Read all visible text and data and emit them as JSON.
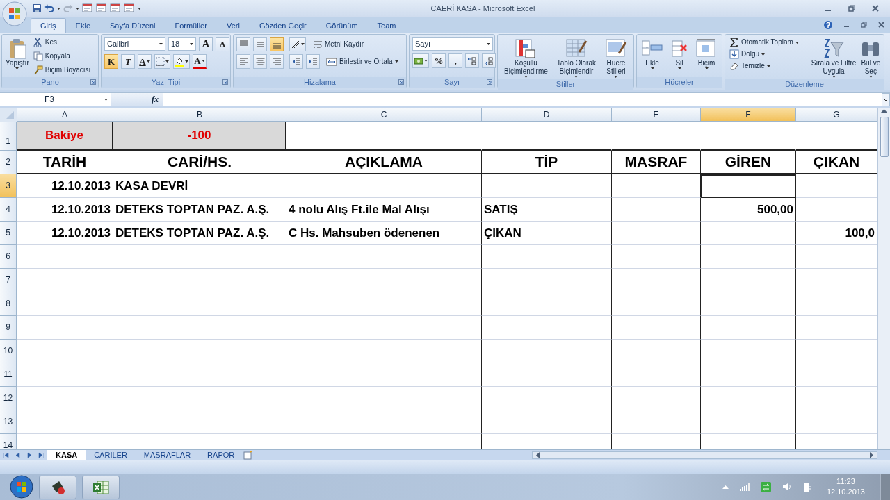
{
  "window": {
    "title": "CAERİ KASA - Microsoft Excel"
  },
  "ribbon_tabs": [
    {
      "label": "Giriş",
      "selected": true
    },
    {
      "label": "Ekle",
      "selected": false
    },
    {
      "label": "Sayfa Düzeni",
      "selected": false
    },
    {
      "label": "Formüller",
      "selected": false
    },
    {
      "label": "Veri",
      "selected": false
    },
    {
      "label": "Gözden Geçir",
      "selected": false
    },
    {
      "label": "Görünüm",
      "selected": false
    },
    {
      "label": "Team",
      "selected": false
    }
  ],
  "clipboard": {
    "label": "Pano",
    "paste": "Yapıştır",
    "commands": [
      "Kes",
      "Kopyala",
      "Biçim Boyacısı"
    ]
  },
  "font": {
    "label": "Yazı Tipi",
    "name": "Calibri",
    "size": "18",
    "grow": "A",
    "shrink": "A",
    "styles": [
      {
        "kind": "bold",
        "label": "K",
        "on": true
      },
      {
        "kind": "italic",
        "label": "T",
        "on": false
      },
      {
        "kind": "underline",
        "label": "A",
        "on": false
      }
    ],
    "color_button": "A"
  },
  "alignment": {
    "label": "Hizalama",
    "vertical": [
      {
        "kind": "top",
        "on": false
      },
      {
        "kind": "middle",
        "on": false
      },
      {
        "kind": "bottom",
        "on": true
      }
    ],
    "wrap": "Metni Kaydır",
    "merge": "Birleştir ve Ortala"
  },
  "number": {
    "label": "Sayı",
    "format": "Sayı",
    "percent": "%",
    "comma": ","
  },
  "styles": {
    "label": "Stiller",
    "buttons": [
      [
        "Koşullu",
        "Biçimlendirme"
      ],
      [
        "Tablo Olarak",
        "Biçimlendir"
      ],
      [
        "Hücre",
        "Stilleri"
      ]
    ]
  },
  "cells": {
    "label": "Hücreler",
    "buttons": [
      "Ekle",
      "Sil",
      "Biçim"
    ]
  },
  "editing": {
    "label": "Düzenleme",
    "commands": [
      "Otomatik Toplam",
      "Dolgu",
      "Temizle"
    ],
    "buttons": [
      [
        "Sırala ve Filtre",
        "Uygula"
      ],
      [
        "Bul ve",
        "Seç"
      ]
    ]
  },
  "formula_bar": {
    "name_box": "F3",
    "function_label": "fx"
  },
  "columns": [
    {
      "label": "A",
      "selected": false
    },
    {
      "label": "B",
      "selected": false
    },
    {
      "label": "C",
      "selected": false
    },
    {
      "label": "D",
      "selected": false
    },
    {
      "label": "E",
      "selected": false
    },
    {
      "label": "F",
      "selected": true
    },
    {
      "label": "G",
      "selected": false
    }
  ],
  "rows": [
    {
      "number": "1",
      "kind": "balance",
      "cells": [
        {
          "text": "Bakiye",
          "kind": "text",
          "selected": false
        },
        {
          "text": "-100",
          "kind": "number",
          "selected": false
        },
        {
          "selected": false
        },
        {
          "selected": false
        },
        {
          "selected": false
        },
        {
          "selected": false
        },
        {
          "selected": false
        }
      ]
    },
    {
      "number": "2",
      "kind": "header",
      "cells": [
        {
          "text": "TARİH",
          "kind": "text",
          "selected": false
        },
        {
          "text": "CARİ/HS.",
          "kind": "text",
          "selected": false
        },
        {
          "text": "AÇIKLAMA",
          "kind": "text",
          "selected": false
        },
        {
          "text": "TİP",
          "kind": "text",
          "selected": false
        },
        {
          "text": "MASRAF",
          "kind": "text",
          "selected": false
        },
        {
          "text": "GİREN",
          "kind": "text",
          "selected": false
        },
        {
          "text": "ÇIKAN",
          "kind": "text",
          "selected": false
        }
      ]
    },
    {
      "number": "3",
      "kind": "data",
      "cells": [
        {
          "text": "12.10.2013",
          "kind": "number",
          "selected": false
        },
        {
          "text": "KASA DEVRİ",
          "kind": "text",
          "selected": false
        },
        {
          "selected": false
        },
        {
          "selected": false
        },
        {
          "selected": false
        },
        {
          "selected": true
        },
        {
          "selected": false
        }
      ]
    },
    {
      "number": "4",
      "kind": "data",
      "cells": [
        {
          "text": "12.10.2013",
          "kind": "number",
          "selected": false
        },
        {
          "text": "DETEKS TOPTAN PAZ. A.Ş.",
          "kind": "text",
          "selected": false
        },
        {
          "text": "4 nolu Alış Ft.ile Mal Alışı",
          "kind": "text",
          "selected": false
        },
        {
          "text": "SATIŞ",
          "kind": "text",
          "selected": false
        },
        {
          "selected": false
        },
        {
          "text": "500,00",
          "kind": "number",
          "selected": false
        },
        {
          "selected": false
        }
      ]
    },
    {
      "number": "5",
      "kind": "data",
      "cells": [
        {
          "text": "12.10.2013",
          "kind": "number",
          "selected": false
        },
        {
          "text": "DETEKS TOPTAN PAZ. A.Ş.",
          "kind": "text",
          "selected": false
        },
        {
          "text": "C Hs. Mahsuben ödenenen",
          "kind": "text",
          "selected": false
        },
        {
          "text": "ÇIKAN",
          "kind": "text",
          "selected": false
        },
        {
          "selected": false
        },
        {
          "selected": false
        },
        {
          "text": "100,0",
          "kind": "number",
          "selected": false
        }
      ]
    },
    {
      "number": "6",
      "kind": "empty"
    },
    {
      "number": "7",
      "kind": "empty"
    },
    {
      "number": "8",
      "kind": "empty"
    },
    {
      "number": "9",
      "kind": "empty"
    },
    {
      "number": "10",
      "kind": "empty"
    },
    {
      "number": "11",
      "kind": "empty"
    },
    {
      "number": "12",
      "kind": "empty"
    },
    {
      "number": "13",
      "kind": "empty"
    },
    {
      "number": "14",
      "kind": "empty"
    }
  ],
  "sheet_tabs": [
    {
      "label": "KASA",
      "selected": true
    },
    {
      "label": "CARİLER",
      "selected": false
    },
    {
      "label": "MASRAFLAR",
      "selected": false
    },
    {
      "label": "RAPOR",
      "selected": false
    }
  ],
  "clock": {
    "time": "11:23",
    "date": "12.10.2013"
  }
}
